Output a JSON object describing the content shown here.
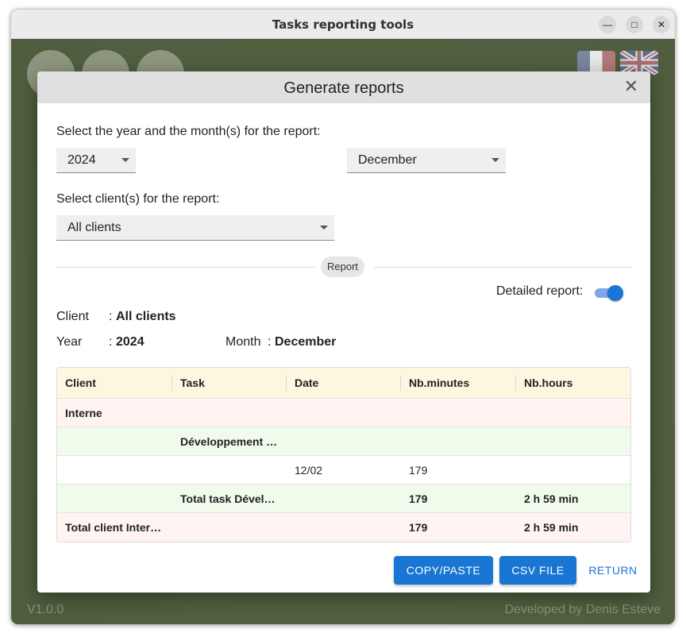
{
  "window": {
    "title": "Tasks reporting tools"
  },
  "app": {
    "version": "V1.0.0",
    "developer": "Developed by Denis Esteve"
  },
  "dialog": {
    "title": "Generate reports",
    "close_glyph": "✕",
    "year_month_label": "Select the year and the month(s) for the report:",
    "year_value": "2024",
    "month_value": "December",
    "client_label": "Select client(s) for the report:",
    "client_value": "All clients",
    "report_chip": "Report",
    "detailed_label": "Detailed report:",
    "detailed_on": true,
    "summary": {
      "client_key": "Client",
      "client_value": "All clients",
      "year_key": "Year",
      "year_value": "2024",
      "month_key": "Month",
      "month_value": "December"
    },
    "table": {
      "headers": [
        "Client",
        "Task",
        "Date",
        "Nb.minutes",
        "Nb.hours"
      ],
      "rows": [
        [
          "Interne",
          "",
          "",
          "",
          ""
        ],
        [
          "",
          "Développement …",
          "",
          "",
          ""
        ],
        [
          "",
          "",
          "12/02",
          "179",
          ""
        ],
        [
          "",
          "Total task Dével…",
          "",
          "179",
          "2 h 59 min"
        ],
        [
          "Total client Inter…",
          "",
          "",
          "179",
          "2 h 59 min"
        ]
      ]
    },
    "buttons": {
      "copy": "COPY/PASTE",
      "csv": "CSV FILE",
      "return": "RETURN"
    }
  },
  "colors": {
    "accent": "#1976d2",
    "header_row": "#fbf8df",
    "client_row": "#fff4f1",
    "task_row": "#f1fbec"
  }
}
